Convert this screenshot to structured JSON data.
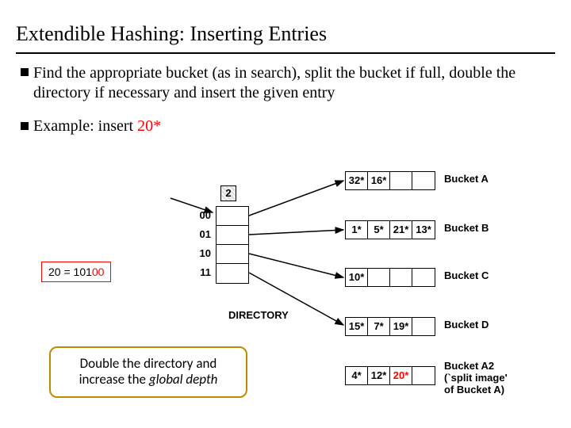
{
  "title": "Extendible Hashing: Inserting Entries",
  "bullets": {
    "main": "Find the appropriate bucket (as in search), split the bucket if full, double the directory if necessary and insert the given entry"
  },
  "example": {
    "prefix": "Example: insert ",
    "value": "20*"
  },
  "binary": {
    "prefix": "20 = 101",
    "suffix": "00"
  },
  "callout": {
    "line1": "Double the directory and",
    "line2_a": "increase the ",
    "line2_b": "global depth"
  },
  "global_depth": "2",
  "directory": {
    "labels": [
      "00",
      "01",
      "10",
      "11"
    ],
    "caption": "DIRECTORY"
  },
  "buckets": {
    "A": {
      "cells": [
        "32*",
        "16*",
        "",
        ""
      ],
      "label": "Bucket A"
    },
    "B": {
      "cells": [
        "1*",
        "5*",
        "21*",
        "13*"
      ],
      "label": "Bucket B"
    },
    "C": {
      "cells": [
        "10*",
        "",
        "",
        ""
      ],
      "label": "Bucket C"
    },
    "D": {
      "cells": [
        "15*",
        "7*",
        "19*",
        ""
      ],
      "label": "Bucket D"
    },
    "A2": {
      "cells": [
        "4*",
        "12*",
        "20*",
        ""
      ],
      "label1": "Bucket A2",
      "label2": "(`split image'",
      "label3": "of Bucket A)"
    }
  }
}
